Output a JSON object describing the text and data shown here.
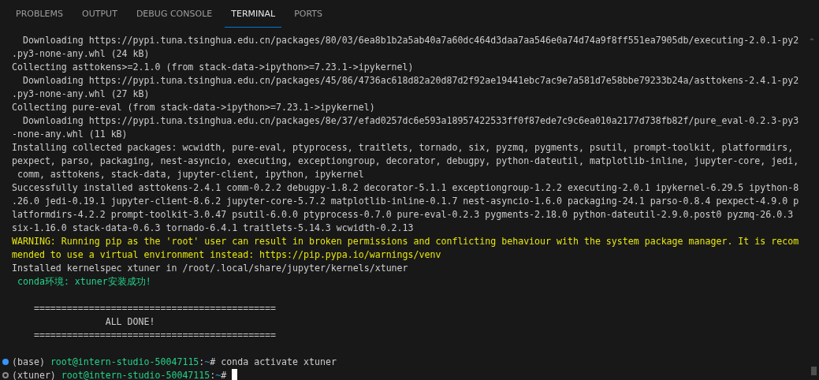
{
  "tabs": [
    {
      "label": "PROBLEMS",
      "selected": false
    },
    {
      "label": "OUTPUT",
      "selected": false
    },
    {
      "label": "DEBUG CONSOLE",
      "selected": false
    },
    {
      "label": "TERMINAL",
      "selected": true
    },
    {
      "label": "PORTS",
      "selected": false
    }
  ],
  "terminal": {
    "lines": [
      {
        "kind": "output",
        "text": "  Downloading https://pypi.tuna.tsinghua.edu.cn/packages/80/03/6ea8b1b2a5ab40a7a60dc464d3daa7aa546e0a74d74a9f8ff551ea7905db/executing-2.0.1-py2"
      },
      {
        "kind": "output",
        "text": ".py3-none-any.whl (24 kB)"
      },
      {
        "kind": "output",
        "text": "Collecting asttokens>=2.1.0 (from stack-data->ipython>=7.23.1->ipykernel)"
      },
      {
        "kind": "output",
        "text": "  Downloading https://pypi.tuna.tsinghua.edu.cn/packages/45/86/4736ac618d82a20d87d2f92ae19441ebc7ac9e7a581d7e58bbe79233b24a/asttokens-2.4.1-py2"
      },
      {
        "kind": "output",
        "text": ".py3-none-any.whl (27 kB)"
      },
      {
        "kind": "output",
        "text": "Collecting pure-eval (from stack-data->ipython>=7.23.1->ipykernel)"
      },
      {
        "kind": "output",
        "text": "  Downloading https://pypi.tuna.tsinghua.edu.cn/packages/8e/37/efad0257dc6e593a18957422533ff0f87ede7c9c6ea010a2177d738fb82f/pure_eval-0.2.3-py3"
      },
      {
        "kind": "output",
        "text": "-none-any.whl (11 kB)"
      },
      {
        "kind": "output",
        "text": "Installing collected packages: wcwidth, pure-eval, ptyprocess, traitlets, tornado, six, pyzmq, pygments, psutil, prompt-toolkit, platformdirs,"
      },
      {
        "kind": "output",
        "text": "pexpect, parso, packaging, nest-asyncio, executing, exceptiongroup, decorator, debugpy, python-dateutil, matplotlib-inline, jupyter-core, jedi,"
      },
      {
        "kind": "output",
        "text": " comm, asttokens, stack-data, jupyter-client, ipython, ipykernel"
      },
      {
        "kind": "output",
        "text": "Successfully installed asttokens-2.4.1 comm-0.2.2 debugpy-1.8.2 decorator-5.1.1 exceptiongroup-1.2.2 executing-2.0.1 ipykernel-6.29.5 ipython-8"
      },
      {
        "kind": "output",
        "text": ".26.0 jedi-0.19.1 jupyter-client-8.6.2 jupyter-core-5.7.2 matplotlib-inline-0.1.7 nest-asyncio-1.6.0 packaging-24.1 parso-0.8.4 pexpect-4.9.0 p"
      },
      {
        "kind": "output",
        "text": "latformdirs-4.2.2 prompt-toolkit-3.0.47 psutil-6.0.0 ptyprocess-0.7.0 pure-eval-0.2.3 pygments-2.18.0 python-dateutil-2.9.0.post0 pyzmq-26.0.3"
      },
      {
        "kind": "output",
        "text": "six-1.16.0 stack-data-0.6.3 tornado-6.4.1 traitlets-5.14.3 wcwidth-0.2.13"
      },
      {
        "kind": "warning",
        "text": "WARNING: Running pip as the 'root' user can result in broken permissions and conflicting behaviour with the system package manager. It is recom"
      },
      {
        "kind": "warning",
        "text": "mended to use a virtual environment instead: https://pip.pypa.io/warnings/venv"
      },
      {
        "kind": "output",
        "text": "Installed kernelspec xtuner in /root/.local/share/jupyter/kernels/xtuner"
      },
      {
        "kind": "success",
        "text": " conda环境: xtuner安装成功!"
      },
      {
        "kind": "blank"
      },
      {
        "kind": "output",
        "text": "    ============================================"
      },
      {
        "kind": "output",
        "text": "                 ALL DONE!"
      },
      {
        "kind": "output",
        "text": "    ============================================"
      },
      {
        "kind": "blank"
      },
      {
        "kind": "prompt",
        "completed": true,
        "env": "(base) ",
        "user_host": "root@intern-studio-50047115",
        "colon": ":",
        "path": "~",
        "symbol": "# ",
        "command": "conda activate xtuner"
      },
      {
        "kind": "prompt",
        "completed": false,
        "env": "(xtuner) ",
        "user_host": "root@intern-studio-50047115",
        "colon": ":",
        "path": "~",
        "symbol": "# ",
        "cursor": true
      }
    ]
  }
}
